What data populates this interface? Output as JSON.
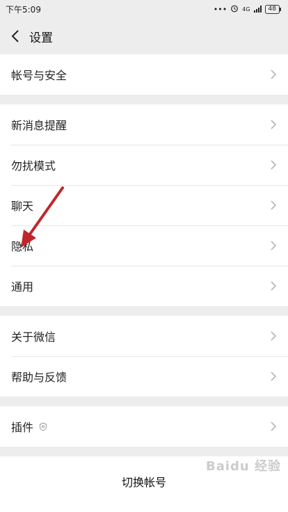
{
  "status": {
    "time": "下午5:09",
    "dots": "•••",
    "network": "4G",
    "battery": "48"
  },
  "nav": {
    "title": "设置"
  },
  "groups": {
    "account": [
      "帐号与安全"
    ],
    "settings": [
      "新消息提醒",
      "勿扰模式",
      "聊天",
      "隐私",
      "通用"
    ],
    "about": [
      "关于微信",
      "帮助与反馈"
    ],
    "plugins": [
      "插件"
    ]
  },
  "footer": {
    "switch_account": "切换帐号"
  },
  "watermark": "Baidu 经验",
  "colors": {
    "background": "#ededed",
    "annotation_arrow": "#c0272d"
  },
  "icons": {
    "back": "chevron-left-icon",
    "row": "chevron-right-icon",
    "plugin_badge": "shield-icon",
    "alarm": "alarm-clock-icon"
  }
}
